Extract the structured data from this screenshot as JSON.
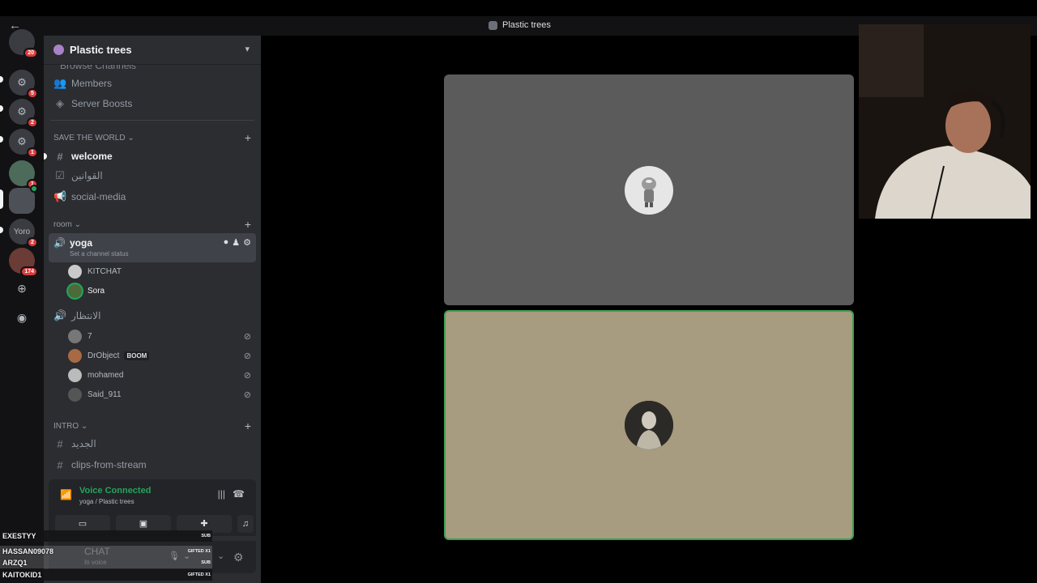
{
  "window": {
    "title": "Plastic trees"
  },
  "rail": {
    "servers": [
      {
        "name": "server-1",
        "badge": "20",
        "badge_color": "red"
      },
      {
        "name": "server-2",
        "badge": "5",
        "badge_color": "red"
      },
      {
        "name": "server-3",
        "badge": "2",
        "badge_color": "red"
      },
      {
        "name": "server-4",
        "badge": "1",
        "badge_color": "red"
      },
      {
        "name": "server-5",
        "badge": "1",
        "badge_color": "red"
      },
      {
        "name": "server-6",
        "badge": "",
        "badge_color": "green"
      },
      {
        "name": "server-7",
        "label": "Yoro",
        "badge": "2",
        "badge_color": "red"
      },
      {
        "name": "server-8",
        "badge": "174",
        "badge_color": "red"
      }
    ]
  },
  "sidebar": {
    "server_name": "Plastic trees",
    "hidden_row": "Browse Channels",
    "top_items": [
      {
        "label": "Members"
      },
      {
        "label": "Server Boosts"
      }
    ],
    "categories": {
      "save_the_world": "SAVE THE WORLD",
      "room": "room",
      "intro": "INTRO"
    },
    "channels": {
      "welcome": "welcome",
      "rules": "القوانين",
      "social": "social-media",
      "yoga": "yoga",
      "yoga_status": "Set a channel status",
      "waiting": "الانتظار",
      "new": "الجديد",
      "clips": "clips-from-stream"
    },
    "yoga_users": [
      {
        "name": "KITCHAT"
      },
      {
        "name": "Sora"
      }
    ],
    "waiting_users": [
      {
        "name": "7"
      },
      {
        "name": "DrObject",
        "tag": "BOOM"
      },
      {
        "name": "mohamed"
      },
      {
        "name": "Said_911"
      }
    ]
  },
  "voice_panel": {
    "status": "Voice Connected",
    "location": "yoga / Plastic trees"
  },
  "user_bar": {
    "name": "CHAT",
    "status": "In voice"
  },
  "overlay": {
    "subs": [
      {
        "name": "EXESTYY",
        "kind": "SUB"
      },
      {
        "name": "HASSAN09078",
        "kind": "GIFTED X1"
      },
      {
        "name": "ARZQ1",
        "kind": "SUB"
      },
      {
        "name": "KAITOKID1",
        "kind": "GIFTED X1"
      }
    ]
  },
  "colors": {
    "accent_green": "#23a55a",
    "badge_red": "#d83c3e",
    "speaking_border": "#3f9f52"
  }
}
